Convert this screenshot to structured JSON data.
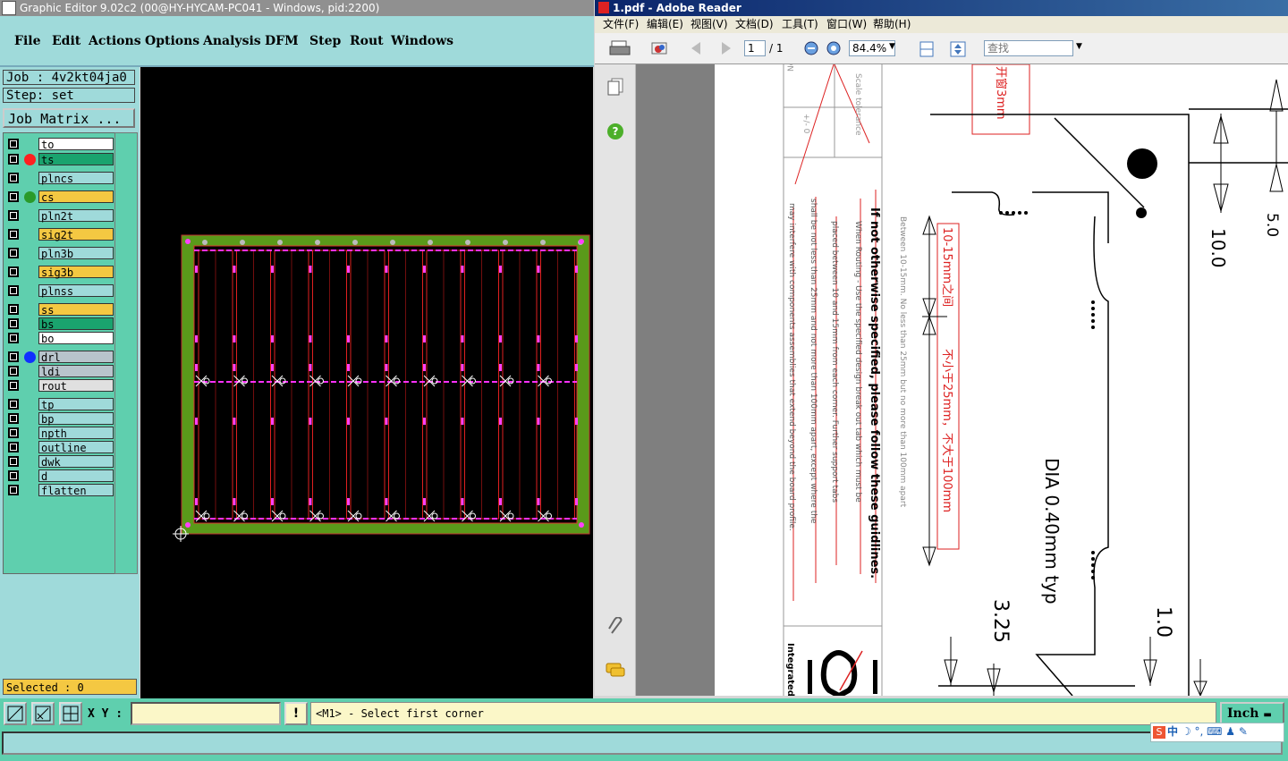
{
  "genesis": {
    "title": "Graphic Editor 9.02c2 (00@HY-HYCAM-PC041 - Windows, pid:2200)",
    "menu": [
      "File",
      "Edit",
      "Actions",
      "Options",
      "Analysis",
      "DFM",
      "Step",
      "Rout",
      "Windows"
    ],
    "job_label": "Job : 4v2kt04ja0",
    "step_label": "Step: set",
    "job_matrix_button": "Job Matrix ...",
    "layers": [
      {
        "name": "to",
        "color": "#ffffff",
        "dot": ""
      },
      {
        "name": "ts",
        "color": "#1aa36e",
        "dot": "#ff2020"
      },
      {
        "name": "plncs",
        "color": "#9fdada",
        "dot": ""
      },
      {
        "name": "cs",
        "color": "#f4c842",
        "dot": "#2a9a2a"
      },
      {
        "name": "pln2t",
        "color": "#9fdada",
        "dot": ""
      },
      {
        "name": "sig2t",
        "color": "#f4c842",
        "dot": ""
      },
      {
        "name": "pln3b",
        "color": "#9fdada",
        "dot": ""
      },
      {
        "name": "sig3b",
        "color": "#f4c842",
        "dot": ""
      },
      {
        "name": "plnss",
        "color": "#9fdada",
        "dot": ""
      },
      {
        "name": "ss",
        "color": "#f4c842",
        "dot": ""
      },
      {
        "name": "bs",
        "color": "#1aa36e",
        "dot": ""
      },
      {
        "name": "bo",
        "color": "#ffffff",
        "dot": ""
      },
      {
        "name": "drl",
        "color": "#b8c4cc",
        "dot": "#1030ff"
      },
      {
        "name": "ldi",
        "color": "#b8c4cc",
        "dot": ""
      },
      {
        "name": "rout",
        "color": "#e0e0e0",
        "dot": ""
      },
      {
        "name": "tp",
        "color": "#9fdada",
        "dot": ""
      },
      {
        "name": "bp",
        "color": "#9fdada",
        "dot": ""
      },
      {
        "name": "npth",
        "color": "#9fdada",
        "dot": ""
      },
      {
        "name": "outline",
        "color": "#9fdada",
        "dot": ""
      },
      {
        "name": "dwk",
        "color": "#9fdada",
        "dot": ""
      },
      {
        "name": "d",
        "color": "#9fdada",
        "dot": ""
      },
      {
        "name": "flatten",
        "color": "#9fdada",
        "dot": ""
      }
    ],
    "selected_label": "Selected : 0",
    "xy_label": "X Y :",
    "xy_value": "",
    "warn_label": "!",
    "prompt": "<M1> - Select first corner",
    "units": "Inch"
  },
  "reader": {
    "title": "1.pdf - Adobe Reader",
    "menu": [
      "文件(F)",
      "编辑(E)",
      "视图(V)",
      "文档(D)",
      "工具(T)",
      "窗口(W)",
      "帮助(H)"
    ],
    "page_current": "1",
    "page_total": "/ 1",
    "zoom": "84.4%",
    "search_placeholder": "查找",
    "doc": {
      "guideline_title": "If not otherwise specified, please follow these guidlines.",
      "red_box_1": "10-15mm之间",
      "red_box_2": "不小于25mm，不大于100mm",
      "red_box_top": "开窗3mm",
      "dia_text": "DIA 0.40mm typ",
      "dim_10": "10.0",
      "dim_5": "5.0",
      "dim_1": "1.0",
      "dim_325": "3.25",
      "between_text": "Between 10-15mm. No less than 25mm but no more than 100mm apart",
      "when_routing": "When Routing - Use the specified design break out tab which must be",
      "placed_between": "placed between 10 and 15mm from each corner. Further support tabs",
      "shall_not": "shall be not less than 25mm and not more than 100mm apart, except where the",
      "may_interfere": "may interfere with components assemblies that extend beyond the board profile.",
      "integrated": "Integrated",
      "not_to_scale": "Not to scale",
      "scale_tol": "Scale tolerance",
      "plus_minus": "+/- 0"
    }
  },
  "ime": {
    "label": "中"
  }
}
